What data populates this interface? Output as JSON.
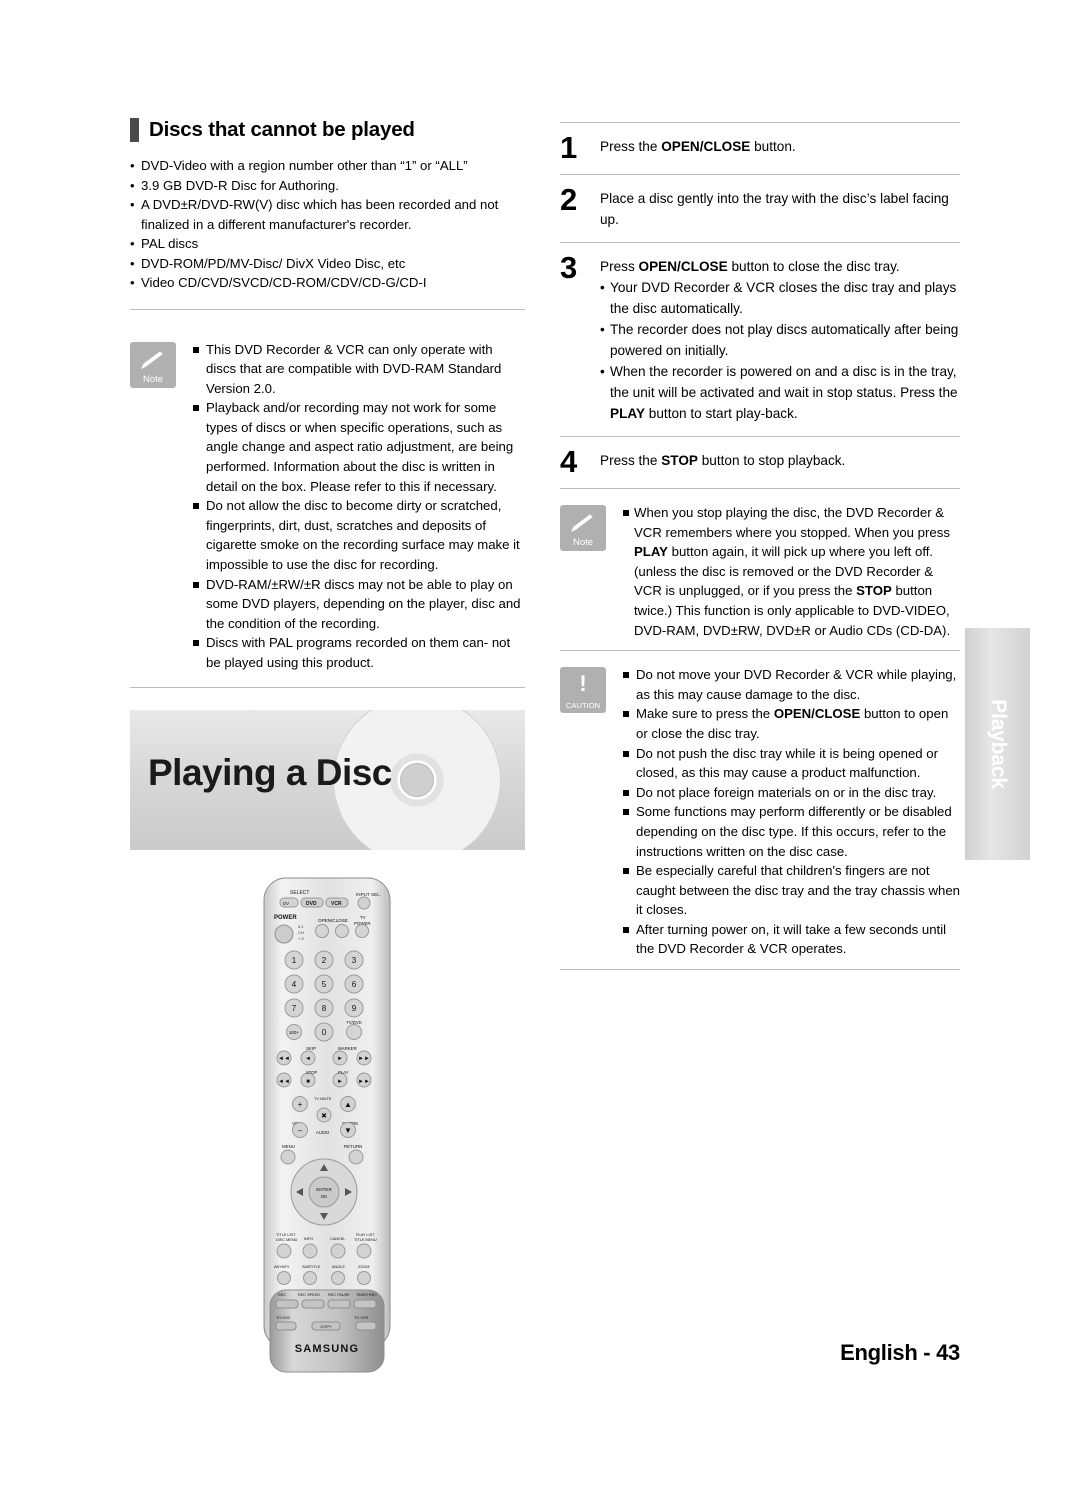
{
  "page": {
    "footer": "English - 43",
    "side_tab": "Playback"
  },
  "left": {
    "section_title": "Discs that cannot be played",
    "bullets": [
      "DVD-Video with a region number other than “1” or “ALL”",
      "3.9 GB DVD-R Disc for Authoring.",
      "A DVD±R/DVD-RW(V) disc which has been recorded and not finalized in a different manufacturer's recorder.",
      "PAL discs",
      "DVD-ROM/PD/MV-Disc/ DivX Video Disc, etc",
      "Video CD/CVD/SVCD/CD-ROM/CDV/CD-G/CD-I"
    ],
    "note_label": "Note",
    "note_items": [
      "This DVD Recorder & VCR can only operate with discs that are compatible with DVD-RAM Standard Version 2.0.",
      "Playback and/or recording may not work for some types of discs or when specific operations, such as angle change and aspect ratio adjustment, are being performed. Information about the disc is written in detail on the box. Please refer to this if necessary.",
      "Do not allow the disc to become dirty or scratched, fingerprints, dirt, dust, scratches and deposits of cigarette smoke on the recording surface may make it impossible to use the disc for recording.",
      "DVD-RAM/±RW/±R discs may not be able to play on some DVD players, depending on the player, disc and the condition of the recording.",
      "Discs with PAL programs recorded on them can- not be played using this product."
    ],
    "banner_title": "Playing a Disc",
    "remote": {
      "brand": "SAMSUNG",
      "select_label": "SELECT",
      "input_sel_label": "INPUT SEL.",
      "power_label": "POWER",
      "open_close_label": "OPEN/CLOSE",
      "tv_power_label": "TV POWER",
      "source_buttons": [
        "DV",
        "DVD",
        "VCR"
      ],
      "numbers": [
        "1",
        "2",
        "3",
        "4",
        "5",
        "6",
        "7",
        "8",
        "9",
        "0"
      ],
      "number_extra_left": "100+",
      "number_extra_right": "TV/DVD",
      "row_labels_1": [
        "SKIP",
        "MARKER"
      ],
      "row_labels_2": [
        "STOP",
        "PLAY"
      ],
      "row_labels_3": [
        "TV MUTE"
      ],
      "row_labels_4": [
        "VOL",
        "CH/TRK"
      ],
      "audio_label": "AUDIO",
      "menu_label": "MENU",
      "return_label": "RETURN",
      "enter_label": "ENTER/OK",
      "bottom_labels_1": [
        "TITLE LIST\nDISC MENU",
        "INFO",
        "CANCEL",
        "PLAY LIST\nTITLE MENU"
      ],
      "bottom_labels_2": [
        "ANYKEY",
        "SUBTITLE",
        "ANGLE",
        "ZOOM"
      ],
      "bottom_labels_3": [
        "REC",
        "REC SPEED",
        "REC PAUSE",
        "TIMER REC"
      ],
      "bottom_labels_4": [
        "TO DVD",
        "COPY",
        "TO VCR"
      ]
    }
  },
  "right": {
    "steps": [
      {
        "num": "1",
        "lines": [
          {
            "type": "plain",
            "text_parts": [
              {
                "t": "Press the ",
                "b": false
              },
              {
                "t": "OPEN/CLOSE",
                "b": true
              },
              {
                "t": " button.",
                "b": false
              }
            ]
          }
        ]
      },
      {
        "num": "2",
        "lines": [
          {
            "type": "plain",
            "text_parts": [
              {
                "t": "Place a disc gently into the tray with the disc’s label facing up.",
                "b": false
              }
            ]
          }
        ]
      },
      {
        "num": "3",
        "lines": [
          {
            "type": "plain",
            "text_parts": [
              {
                "t": "Press ",
                "b": false
              },
              {
                "t": "OPEN/CLOSE",
                "b": true
              },
              {
                "t": " button to close the disc tray.",
                "b": false
              }
            ]
          },
          {
            "type": "dot",
            "text_parts": [
              {
                "t": "Your DVD Recorder & VCR closes the disc tray and plays the disc automatically.",
                "b": false
              }
            ]
          },
          {
            "type": "dot",
            "text_parts": [
              {
                "t": "The recorder does not play discs automatically after being powered on initially.",
                "b": false
              }
            ]
          },
          {
            "type": "dot",
            "text_parts": [
              {
                "t": "When the recorder is powered on and a disc is in the tray, the unit will be activated and wait in stop status. Press the ",
                "b": false
              },
              {
                "t": "PLAY",
                "b": true
              },
              {
                "t": " button to start play-back.",
                "b": false
              }
            ]
          }
        ]
      },
      {
        "num": "4",
        "lines": [
          {
            "type": "plain",
            "text_parts": [
              {
                "t": "Press the ",
                "b": false
              },
              {
                "t": "STOP",
                "b": true
              },
              {
                "t": " button to stop playback.",
                "b": false
              }
            ]
          }
        ]
      }
    ],
    "note_label": "Note",
    "note_text_parts": [
      {
        "t": "When you stop playing the disc, the DVD Recorder & VCR remembers where you stopped. When you press ",
        "b": false
      },
      {
        "t": "PLAY",
        "b": true
      },
      {
        "t": " button again, it will pick up where you left off. (unless the disc is removed or the DVD Recorder & VCR is unplugged, or if you press the ",
        "b": false
      },
      {
        "t": "STOP",
        "b": true
      },
      {
        "t": " button twice.) This function is only applicable to DVD-VIDEO, DVD-RAM, DVD±RW, DVD±R or Audio CDs (CD-DA).",
        "b": false
      }
    ],
    "caution_label": "CAUTION",
    "caution_items": [
      [
        {
          "t": "Do not move your DVD Recorder & VCR while playing, as this may cause damage to the disc.",
          "b": false
        }
      ],
      [
        {
          "t": "Make sure to press the ",
          "b": false
        },
        {
          "t": "OPEN/CLOSE",
          "b": true
        },
        {
          "t": " button to open or close the disc tray.",
          "b": false
        }
      ],
      [
        {
          "t": "Do not push the disc tray while it is being opened or closed, as this may cause a product malfunction.",
          "b": false
        }
      ],
      [
        {
          "t": "Do not place foreign materials on or in the disc tray.",
          "b": false
        }
      ],
      [
        {
          "t": "Some functions may perform differently or be disabled depending on the disc type. If this occurs, refer to the instructions written on the disc case.",
          "b": false
        }
      ],
      [
        {
          "t": "Be especially careful that children's fingers are not caught between the disc tray and the tray chassis when it closes.",
          "b": false
        }
      ],
      [
        {
          "t": "After turning power on, it will take a few seconds until the DVD Recorder & VCR operates.",
          "b": false
        }
      ]
    ]
  }
}
